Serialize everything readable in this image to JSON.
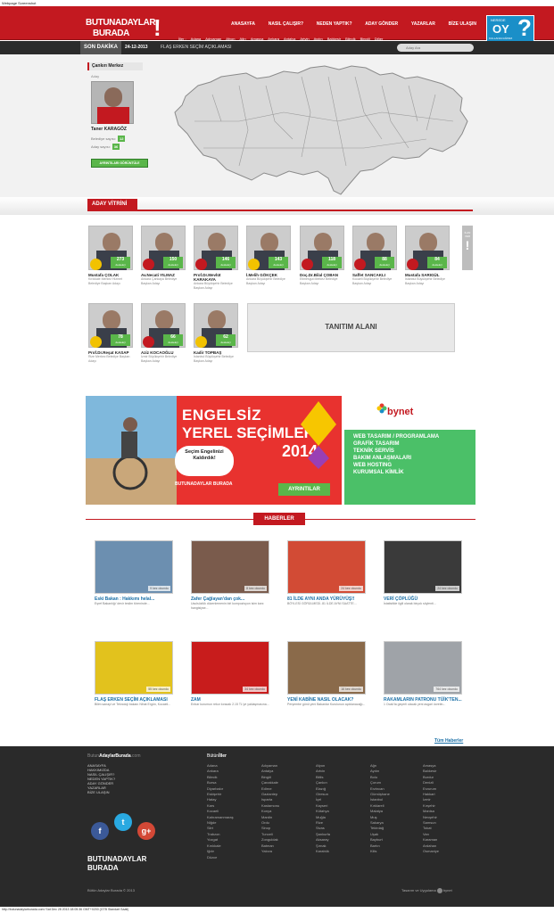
{
  "page_caption": "Webpage Screenshot",
  "logo": {
    "line1": "BUTUNADAYLAR",
    "line2": "BURADA",
    "mark": "!"
  },
  "nav": [
    "ANASAYFA",
    "NASIL ÇALIŞIR?",
    "NEDEN YAPTIK?",
    "ADAY GÖNDER",
    "YAZARLAR",
    "BİZE ULAŞIN"
  ],
  "cities": [
    "İller :",
    "Adana",
    "Adıyaman",
    "Afyon",
    "Ağrı",
    "Amasya",
    "Ankara",
    "Antalya",
    "Artvin",
    "Aydın",
    "Balıkesir",
    "Bilecik",
    "Bingöl",
    "Diğer"
  ],
  "vote_box": {
    "top": "NEREDE",
    "big": "OY",
    "q": "?",
    "sub": "KULLANACAĞIMIZ",
    "button": "SORGULA"
  },
  "ticker": {
    "label": "SON DAKİKA",
    "date": "24-12-2013",
    "headline": "FLAŞ ERKEN SEÇİM AÇIKLAMASI",
    "search_placeholder": "Aday Ara"
  },
  "candidate_panel": {
    "header": "Çankırı Merkez",
    "role": "Aday",
    "name": "Taner KARAGÖZ",
    "stat1_label": "Belediye sayısı:",
    "stat1_value": "12",
    "stat2_label": "Aday sayısı:",
    "stat2_value": "36",
    "button": "AYRINTILARI GÖRÜNTÜLE"
  },
  "vitrin_title": "ADAY VİTRİNİ",
  "vitrin_cards": [
    {
      "name": "Mustafa ÇOLAK",
      "desc": "Kırıkkale Merkez Hizmet Belediye Başkan Adayı",
      "votes": "273",
      "vote_label": "destekçi",
      "party": "akp"
    },
    {
      "name": "Av.Necati YILMAZ",
      "desc": "Ankara Çankaya Belediye Başkan Adayı",
      "votes": "150",
      "vote_label": "destekçi",
      "party": "chp"
    },
    {
      "name": "Prof.Dr.Mevlüt KARAKAYA",
      "desc": "Ankara Büyükşehir Belediye Başkan Adayı",
      "votes": "146",
      "vote_label": "destekçi",
      "party": "mhp"
    },
    {
      "name": "İ.Melih GÖKÇEK",
      "desc": "Ankara Büyükşehir Belediye Başkan Adayı",
      "votes": "143",
      "vote_label": "destekçi",
      "party": "akp"
    },
    {
      "name": "Doç.Dr.Bilal ÇOBAN",
      "desc": "Etimesgut Merkez Belediye Başkan Adayı",
      "votes": "118",
      "vote_label": "destekçi",
      "party": "mhp"
    },
    {
      "name": "Saffet SANCAKLI",
      "desc": "Kocaeli Büyükşehir Belediye Başkan Adayı",
      "votes": "88",
      "vote_label": "destekçi",
      "party": "mhp"
    },
    {
      "name": "Mustafa SARIGÜL",
      "desc": "İstanbul Büyükşehir Belediye Başkan Adayı",
      "votes": "84",
      "vote_label": "destekçi",
      "party": "chp"
    },
    {
      "name": "Prof.Dr.Reşat KASAP",
      "desc": "Rize Merkez Belediye Başkan Adayı",
      "votes": "78",
      "vote_label": "destekçi",
      "party": "akp"
    },
    {
      "name": "Aziz KOCAOĞLU",
      "desc": "İzmir Büyükşehir Belediye Başkan Adayı",
      "votes": "66",
      "vote_label": "destekçi",
      "party": "chp"
    },
    {
      "name": "Kadir TOPBAŞ",
      "desc": "İstanbul Büyükşehir Belediye Başkan Adayı",
      "votes": "62",
      "vote_label": "destekçi",
      "party": "akp"
    }
  ],
  "ilan": {
    "top": "İLAN VER",
    "mark": "!"
  },
  "tanitim": "TANITIM ALANI",
  "banner1": {
    "title1": "ENGELSİZ",
    "title2": "YEREL SEÇİMLER",
    "year": "2014",
    "bubble": "Seçim Engelinizi Kaldırdık!",
    "brand": "BUTUNADAYLAR BURADA",
    "details": "AYRINTILAR"
  },
  "banner2": {
    "brand": "bynet",
    "lines": [
      "WEB TASARIM / PROGRAMLAMA",
      "GRAFİK TASARIM",
      "TEKNİK SERVİS",
      "BAKIM ANLAŞMALARI",
      "WEB HOSTING",
      "KURUMSAL KİMLİK"
    ]
  },
  "haberler_title": "HABERLER",
  "news": [
    {
      "title": "Eski Bakan : Hakkımı helal...",
      "summary": "Eşref Bakanlığı' devir teslim töreninde...",
      "views": "9 kez okundu",
      "color": "#6c8fb0"
    },
    {
      "title": "Zafer Çağlayan'dan çok...",
      "summary": "Usulsüzlük düzenlemenin biri kompozisyon isim kanı hangisiyse...",
      "views": "8 kez okundu",
      "color": "#7a5b4c"
    },
    {
      "title": "81 İLDE AYNI ANDA YÜRÜYÜŞ!!",
      "summary": "BÖYLESİ GÖRÜLMEDİ..81 İLDE AYNI SAATTE...",
      "views": "24 kez okundu",
      "color": "#d24b35"
    },
    {
      "title": "VERİ ÇÖPLÜĞÜ",
      "summary": "İstatistikle ilgili olarak birçok söylenti...",
      "views": "24 kez okundu",
      "color": "#3a3a3a"
    },
    {
      "title": "FLAŞ ERKEN SEÇİM AÇIKLAMASI",
      "summary": "Bilim sanayi ve Teknoloji bakanı Nihat Ergün, Kocaeli...",
      "views": "55 kez okundu",
      "color": "#e2c21d"
    },
    {
      "title": "ZAM",
      "summary": "Enbar kurumun rekor kıracak 2.15 TL'ye yaklaşmasına...",
      "views": "34 kez okundu",
      "color": "#c81c1c"
    },
    {
      "title": "YENİ KABİNE NASIL OLACAK?",
      "summary": "Perşembe günü yeni Bakanlar Kurulunun açıklanacağı...",
      "views": "16 kez okundu",
      "color": "#8a6a4a"
    },
    {
      "title": "RAKAMLARIN PATRONU TÜİK'TEN...",
      "summary": "1 Ocak'ta geçerli olacak yeni asgari ücretin...",
      "views": "764 kez okundu",
      "color": "#9fa3a8"
    }
  ],
  "all_news": "Tüm Haberler",
  "footer": {
    "brand_pre": "Butun",
    "brand_bold": "AdaylarBurada",
    "brand_post": ".com",
    "links": [
      "ANASAYFA",
      "HAKKIMIZDA",
      "NASIL ÇALIŞIR?",
      "NEDEN YAPTIK?",
      "ADAY GÖNDER",
      "YAZARLAR",
      "BİZE ULAŞIN"
    ],
    "cities_title_pre": "Bütün",
    "cities_title_bold": "İller",
    "city_cols": [
      [
        "Adana",
        "Ankara",
        "Bilecik",
        "Bursa",
        "Diyarbakır",
        "Eskişehir",
        "Hatay",
        "Kars",
        "Kocaeli",
        "Kahramanmaraş",
        "Niğde",
        "Siirt",
        "Trabzon",
        "Yozgat",
        "Kırıkkale",
        "Iğdır",
        "Düzce"
      ],
      [
        "Adıyaman",
        "Antalya",
        "Bingöl",
        "Çanakkale",
        "Edirne",
        "Gaziantep",
        "Isparta",
        "Kastamonu",
        "Konya",
        "Mardin",
        "Ordu",
        "Sinop",
        "Tunceli",
        "Zonguldak",
        "Batman",
        "Yalova"
      ],
      [
        "Afyon",
        "Artvin",
        "Bitlis",
        "Çankırı",
        "Elazığ",
        "Giresun",
        "İçel",
        "Kayseri",
        "Kütahya",
        "Muğla",
        "Rize",
        "Sivas",
        "Şanlıurfa",
        "Aksaray",
        "Şırnak",
        "Karabük"
      ],
      [
        "Ağrı",
        "Aydın",
        "Bolu",
        "Çorum",
        "Erzincan",
        "Gümüşhane",
        "İstanbul",
        "Kırklareli",
        "Malatya",
        "Muş",
        "Sakarya",
        "Tekirdağ",
        "Uşak",
        "Bayburt",
        "Bartın",
        "Kilis"
      ],
      [
        "Amasya",
        "Balıkesir",
        "Burdur",
        "Denizli",
        "Erzurum",
        "Hakkari",
        "İzmir",
        "Kırşehir",
        "Manisa",
        "Nevşehir",
        "Samsun",
        "Tokat",
        "Van",
        "Karaman",
        "Ardahan",
        "Osmaniye"
      ]
    ],
    "copy": "Bütün Adaylar Burada © 2013",
    "design": "Tasarım ve Uygulama",
    "design_brand": "bynet",
    "logo1": "BUTUNADAYLAR",
    "logo2": "BURADA",
    "logo_mark": "!",
    "social": [
      "f",
      "t",
      "g+"
    ]
  },
  "status_bar": "http://butunadaylarburada.com/ Sat Dec 28 2013 18:05:36 GMT+0200 (GTB Standart Saati)",
  "colors": {
    "brand_red": "#c31920",
    "green": "#5ab64a",
    "dark": "#2a2a2a",
    "blue_link": "#1a6fa6"
  }
}
